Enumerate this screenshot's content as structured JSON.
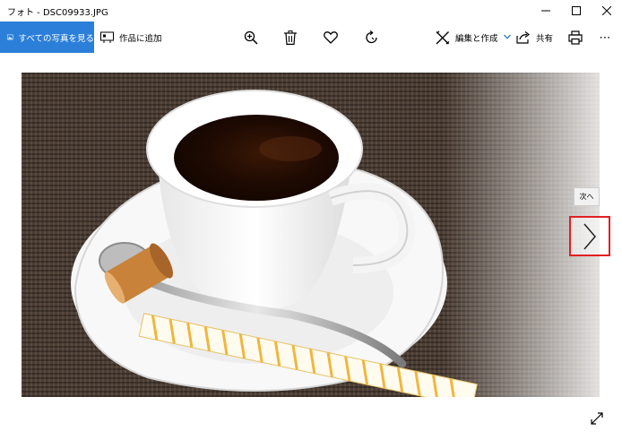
{
  "window": {
    "title": "フォト - DSC09933.JPG",
    "minimize_glyph": "—",
    "maximize_glyph": "☐",
    "close_glyph": "✕"
  },
  "toolbar": {
    "all_photos_label": "すべての写真を見る",
    "add_to_label": "作品に追加",
    "edit_label": "編集と作成",
    "share_label": "共有",
    "more_glyph": "⋯",
    "icons": [
      "zoom-in-icon",
      "trash-icon",
      "heart-icon",
      "rotate-icon",
      "edit-icon",
      "share-icon",
      "print-icon",
      "more-icon"
    ]
  },
  "viewer": {
    "next_tooltip": "次へ",
    "accent_color": "#2b7fd9",
    "highlight_color": "#e02020"
  }
}
